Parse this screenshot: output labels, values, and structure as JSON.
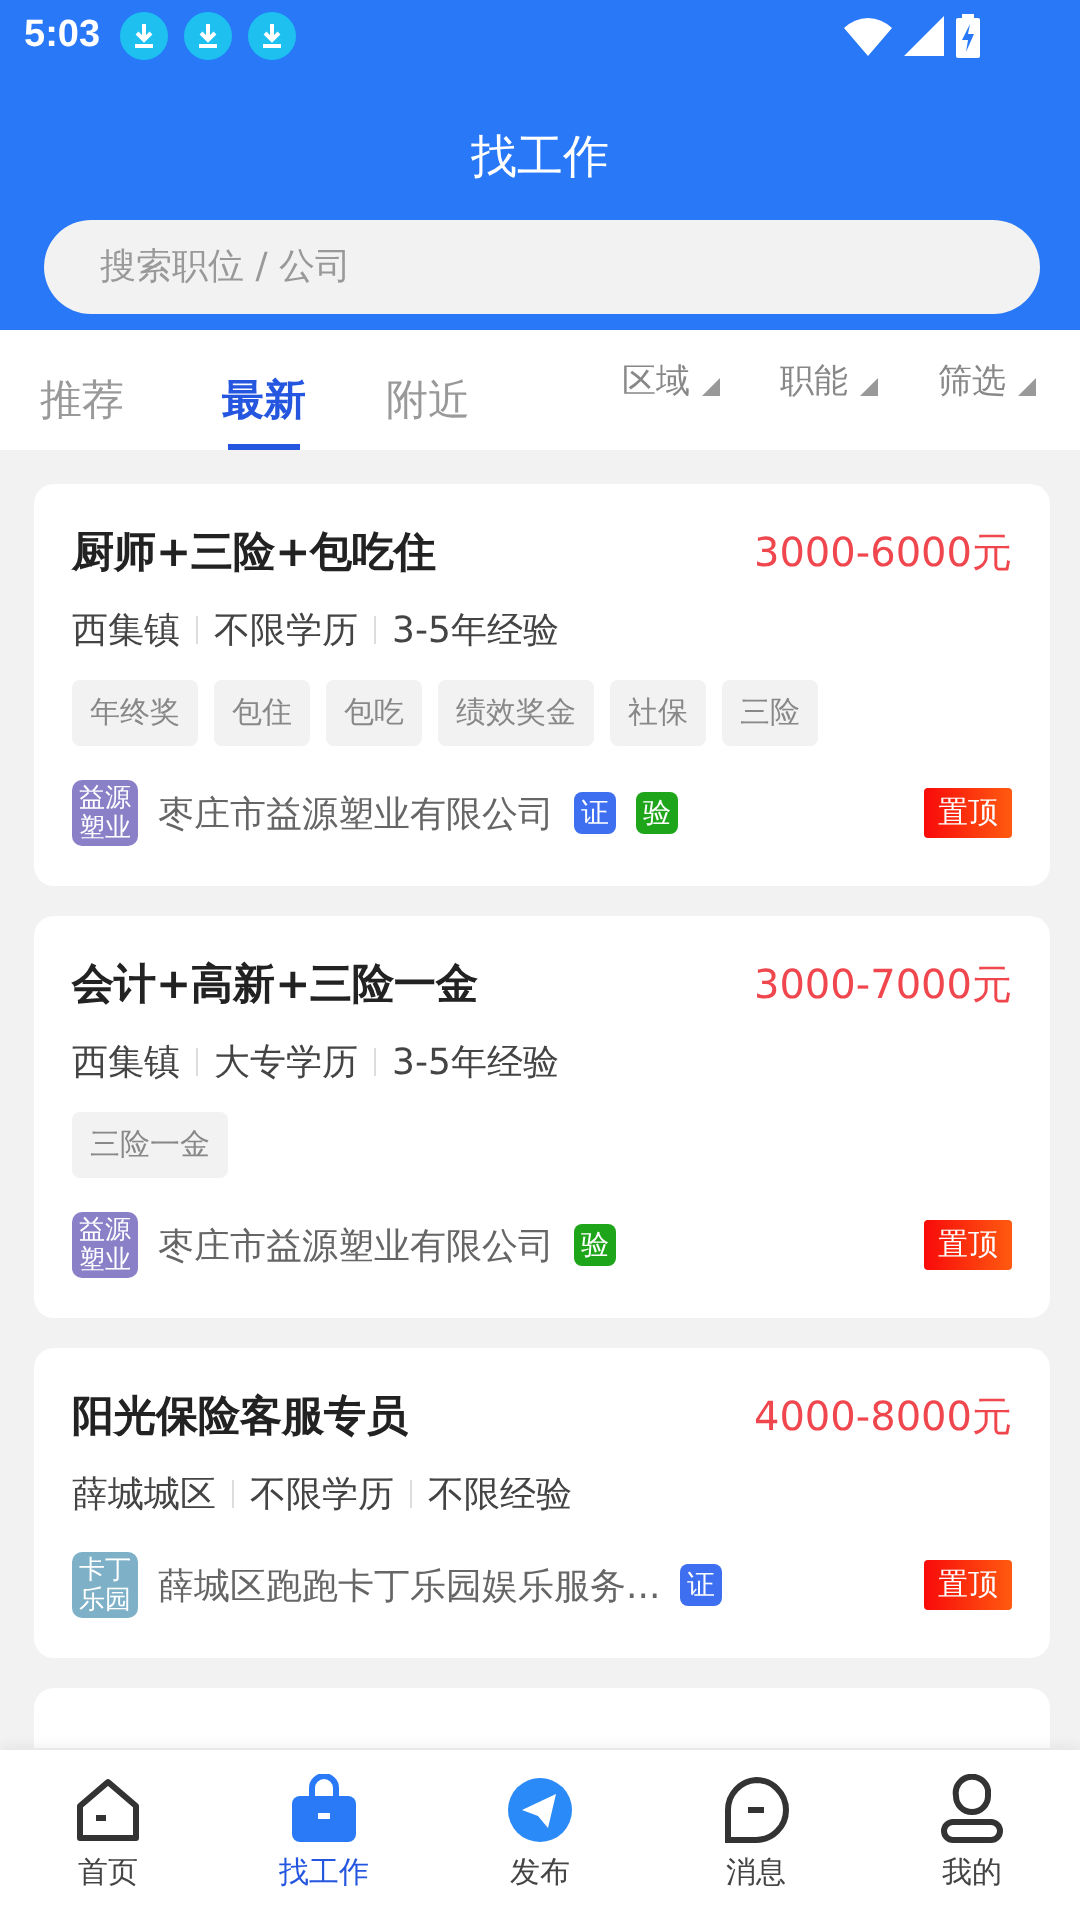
{
  "status_bar": {
    "time": "5:03",
    "notifications": [
      {
        "kind": "download"
      },
      {
        "kind": "download"
      },
      {
        "kind": "download"
      }
    ]
  },
  "header": {
    "title": "找工作"
  },
  "search": {
    "placeholder": "搜索职位 / 公司"
  },
  "tabs": [
    {
      "label": "推荐",
      "selected": false
    },
    {
      "label": "最新",
      "selected": true
    },
    {
      "label": "附近",
      "selected": false
    }
  ],
  "filters": [
    "区域",
    "职能",
    "筛选"
  ],
  "jobs": [
    {
      "title": "厨师+三险+包吃住",
      "salary": "3000-6000元",
      "meta": [
        "西集镇",
        "不限学历",
        "3-5年经验"
      ],
      "tags": [
        "年终奖",
        "包住",
        "包吃",
        "绩效奖金",
        "社保",
        "三险"
      ],
      "logo": {
        "text": "益源塑业",
        "color": "#8a80c8"
      },
      "company": "枣庄市益源塑业有限公司",
      "badges": [
        {
          "kind": "certified",
          "label": "证"
        },
        {
          "kind": "verified",
          "label": "验"
        }
      ],
      "pin": "置顶"
    },
    {
      "title": "会计+高新+三险一金",
      "salary": "3000-7000元",
      "meta": [
        "西集镇",
        "大专学历",
        "3-5年经验"
      ],
      "tags": [
        "三险一金"
      ],
      "logo": {
        "text": "益源塑业",
        "color": "#8a80c8"
      },
      "company": "枣庄市益源塑业有限公司",
      "badges": [
        {
          "kind": "verified",
          "label": "验"
        }
      ],
      "pin": "置顶"
    },
    {
      "title": "阳光保险客服专员",
      "salary": "4000-8000元",
      "meta": [
        "薛城城区",
        "不限学历",
        "不限经验"
      ],
      "logo": {
        "text": "卡丁乐园",
        "color": "#7eb0c8"
      },
      "company": "薛城区跑跑卡丁乐园娱乐服务...",
      "badges": [
        {
          "kind": "certified",
          "label": "证"
        }
      ],
      "pin": "置顶"
    }
  ],
  "nav": [
    {
      "kind": "home",
      "label": "首页",
      "selected": false
    },
    {
      "kind": "job",
      "label": "找工作",
      "selected": true
    },
    {
      "kind": "publish",
      "label": "发布",
      "selected": false
    },
    {
      "kind": "message",
      "label": "消息",
      "selected": false
    },
    {
      "kind": "profile",
      "label": "我的",
      "selected": false
    }
  ]
}
